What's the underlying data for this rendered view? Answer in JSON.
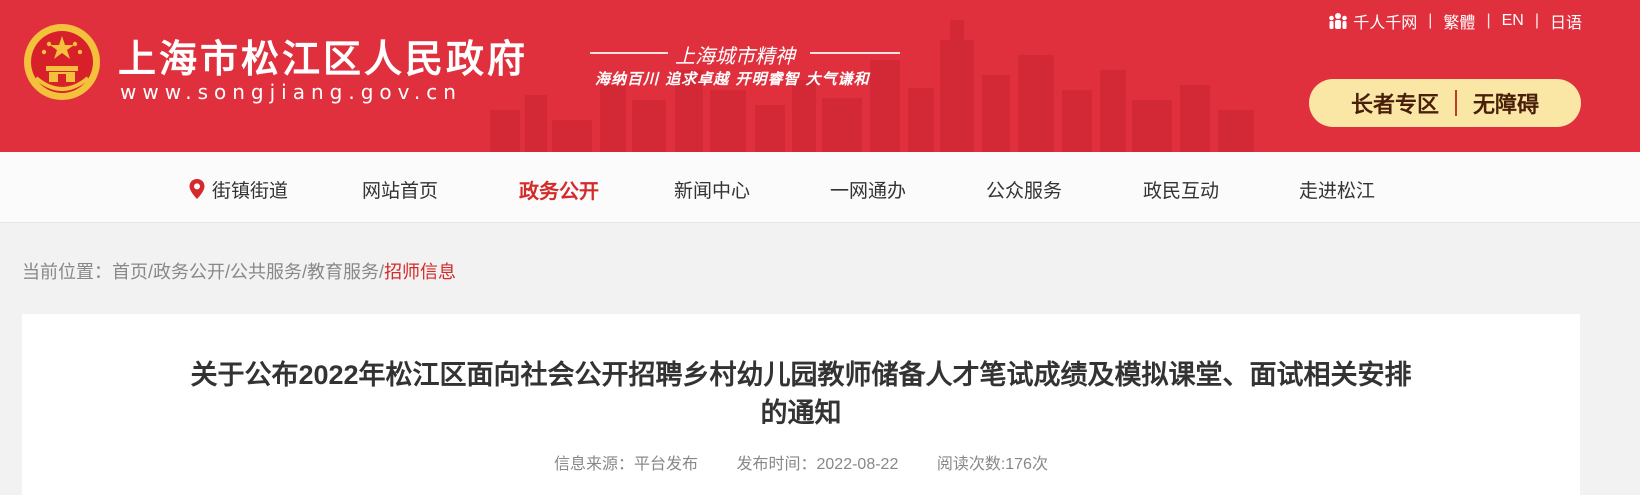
{
  "header": {
    "site_title": "上海市松江区人民政府",
    "site_url": "www.songjiang.gov.cn",
    "spirit_title": "上海城市精神",
    "spirit_subtitle": "海纳百川  追求卓越  开明睿智  大气谦和",
    "top_links": [
      "千人千网",
      "繁體",
      "EN",
      "日语"
    ],
    "elder_zone": "长者专区",
    "accessibility": "无障碍",
    "colors": {
      "brand_red": "#e0303e",
      "pill_bg": "#fbe7a5",
      "active_red": "#d42a2a"
    }
  },
  "nav": {
    "items": [
      "街镇街道",
      "网站首页",
      "政务公开",
      "新闻中心",
      "一网通办",
      "公众服务",
      "政民互动",
      "走进松江"
    ],
    "active": "政务公开"
  },
  "breadcrumb": {
    "prefix": "当前位置：",
    "items": [
      "首页",
      "政务公开",
      "公共服务",
      "教育服务",
      "招师信息"
    ],
    "separator": "/"
  },
  "article": {
    "title_line1": "关于公布2022年松江区面向社会公开招聘乡村幼儿园教师储备人才笔试成绩及模拟课堂、面试相关安排",
    "title_line2": "的通知",
    "source": "信息来源：平台发布",
    "published": "发布时间：2022-08-22",
    "views": "阅读次数:176次"
  }
}
